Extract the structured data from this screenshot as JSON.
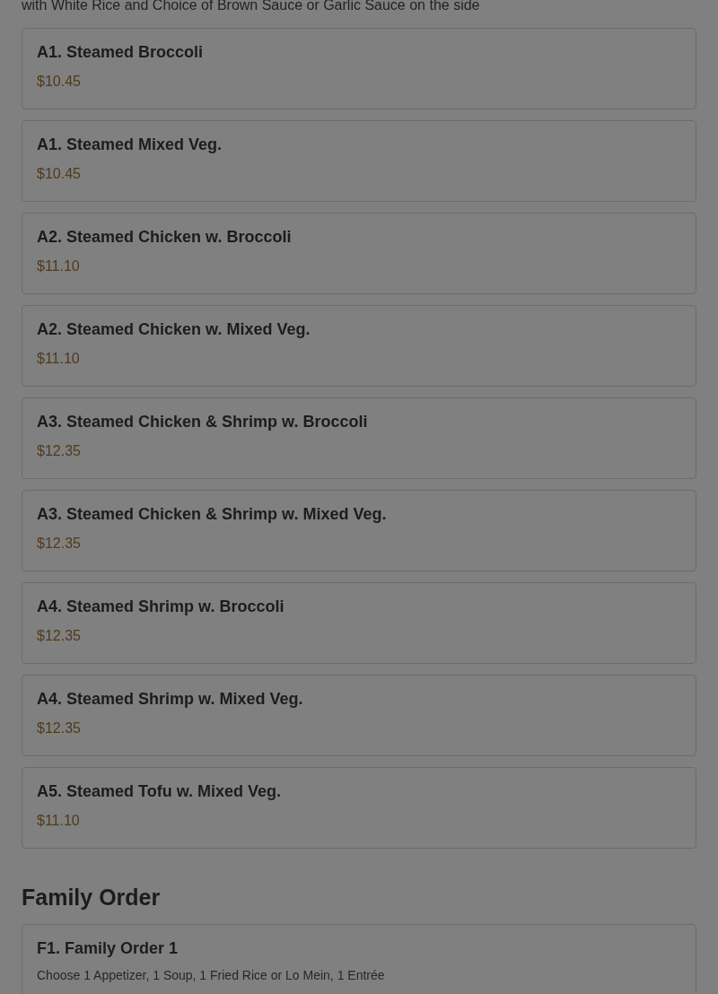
{
  "section_description": "with White Rice and Choice of Brown Sauce or Garlic Sauce on the side",
  "items": [
    {
      "name": "A1. Steamed Broccoli",
      "price": "$10.45"
    },
    {
      "name": "A1. Steamed Mixed Veg.",
      "price": "$10.45"
    },
    {
      "name": "A2. Steamed Chicken w. Broccoli",
      "price": "$11.10"
    },
    {
      "name": "A2. Steamed Chicken w. Mixed Veg.",
      "price": "$11.10"
    },
    {
      "name": "A3. Steamed Chicken & Shrimp w. Broccoli",
      "price": "$12.35"
    },
    {
      "name": "A3. Steamed Chicken & Shrimp w. Mixed Veg.",
      "price": "$12.35"
    },
    {
      "name": "A4. Steamed Shrimp w. Broccoli",
      "price": "$12.35"
    },
    {
      "name": "A4. Steamed Shrimp w. Mixed Veg.",
      "price": "$12.35"
    },
    {
      "name": "A5. Steamed Tofu w. Mixed Veg.",
      "price": "$11.10"
    }
  ],
  "next_section": {
    "title": "Family Order",
    "items": [
      {
        "name": "F1. Family Order 1",
        "description": "Choose 1 Appetizer, 1 Soup, 1 Fried Rice or Lo Mein, 1 Entrée"
      }
    ]
  }
}
